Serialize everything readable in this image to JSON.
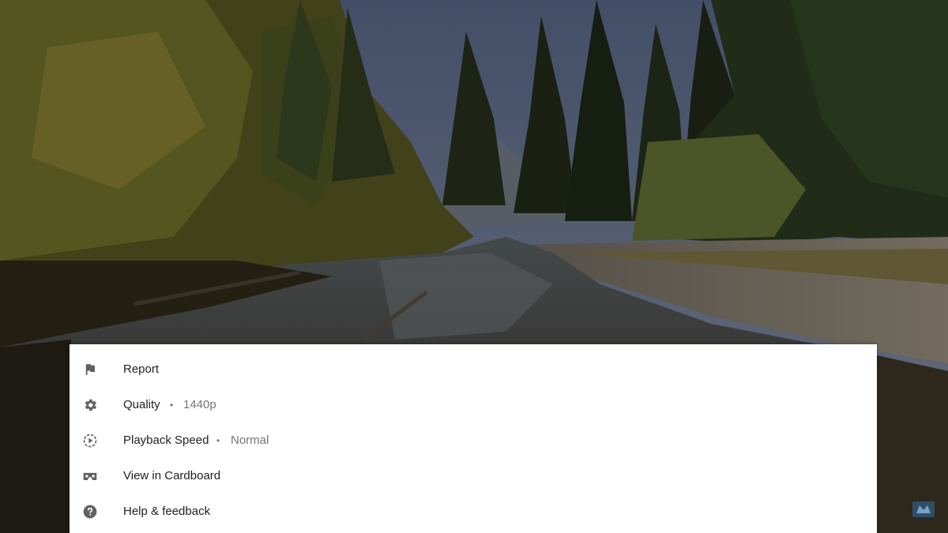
{
  "menu": {
    "items": [
      {
        "label": "Report",
        "icon": "flag-icon"
      },
      {
        "label": "Quality",
        "icon": "gear-icon",
        "value": "1440p"
      },
      {
        "label": "Playback Speed",
        "icon": "playback-speed-icon",
        "value": "Normal"
      },
      {
        "label": "View in Cardboard",
        "icon": "cardboard-icon"
      },
      {
        "label": "Help & feedback",
        "icon": "help-icon"
      }
    ],
    "separator": "•"
  },
  "colors": {
    "sheet_background": "#ffffff",
    "label_text": "#212121",
    "secondary_text": "#757575",
    "icon": "#616161"
  }
}
